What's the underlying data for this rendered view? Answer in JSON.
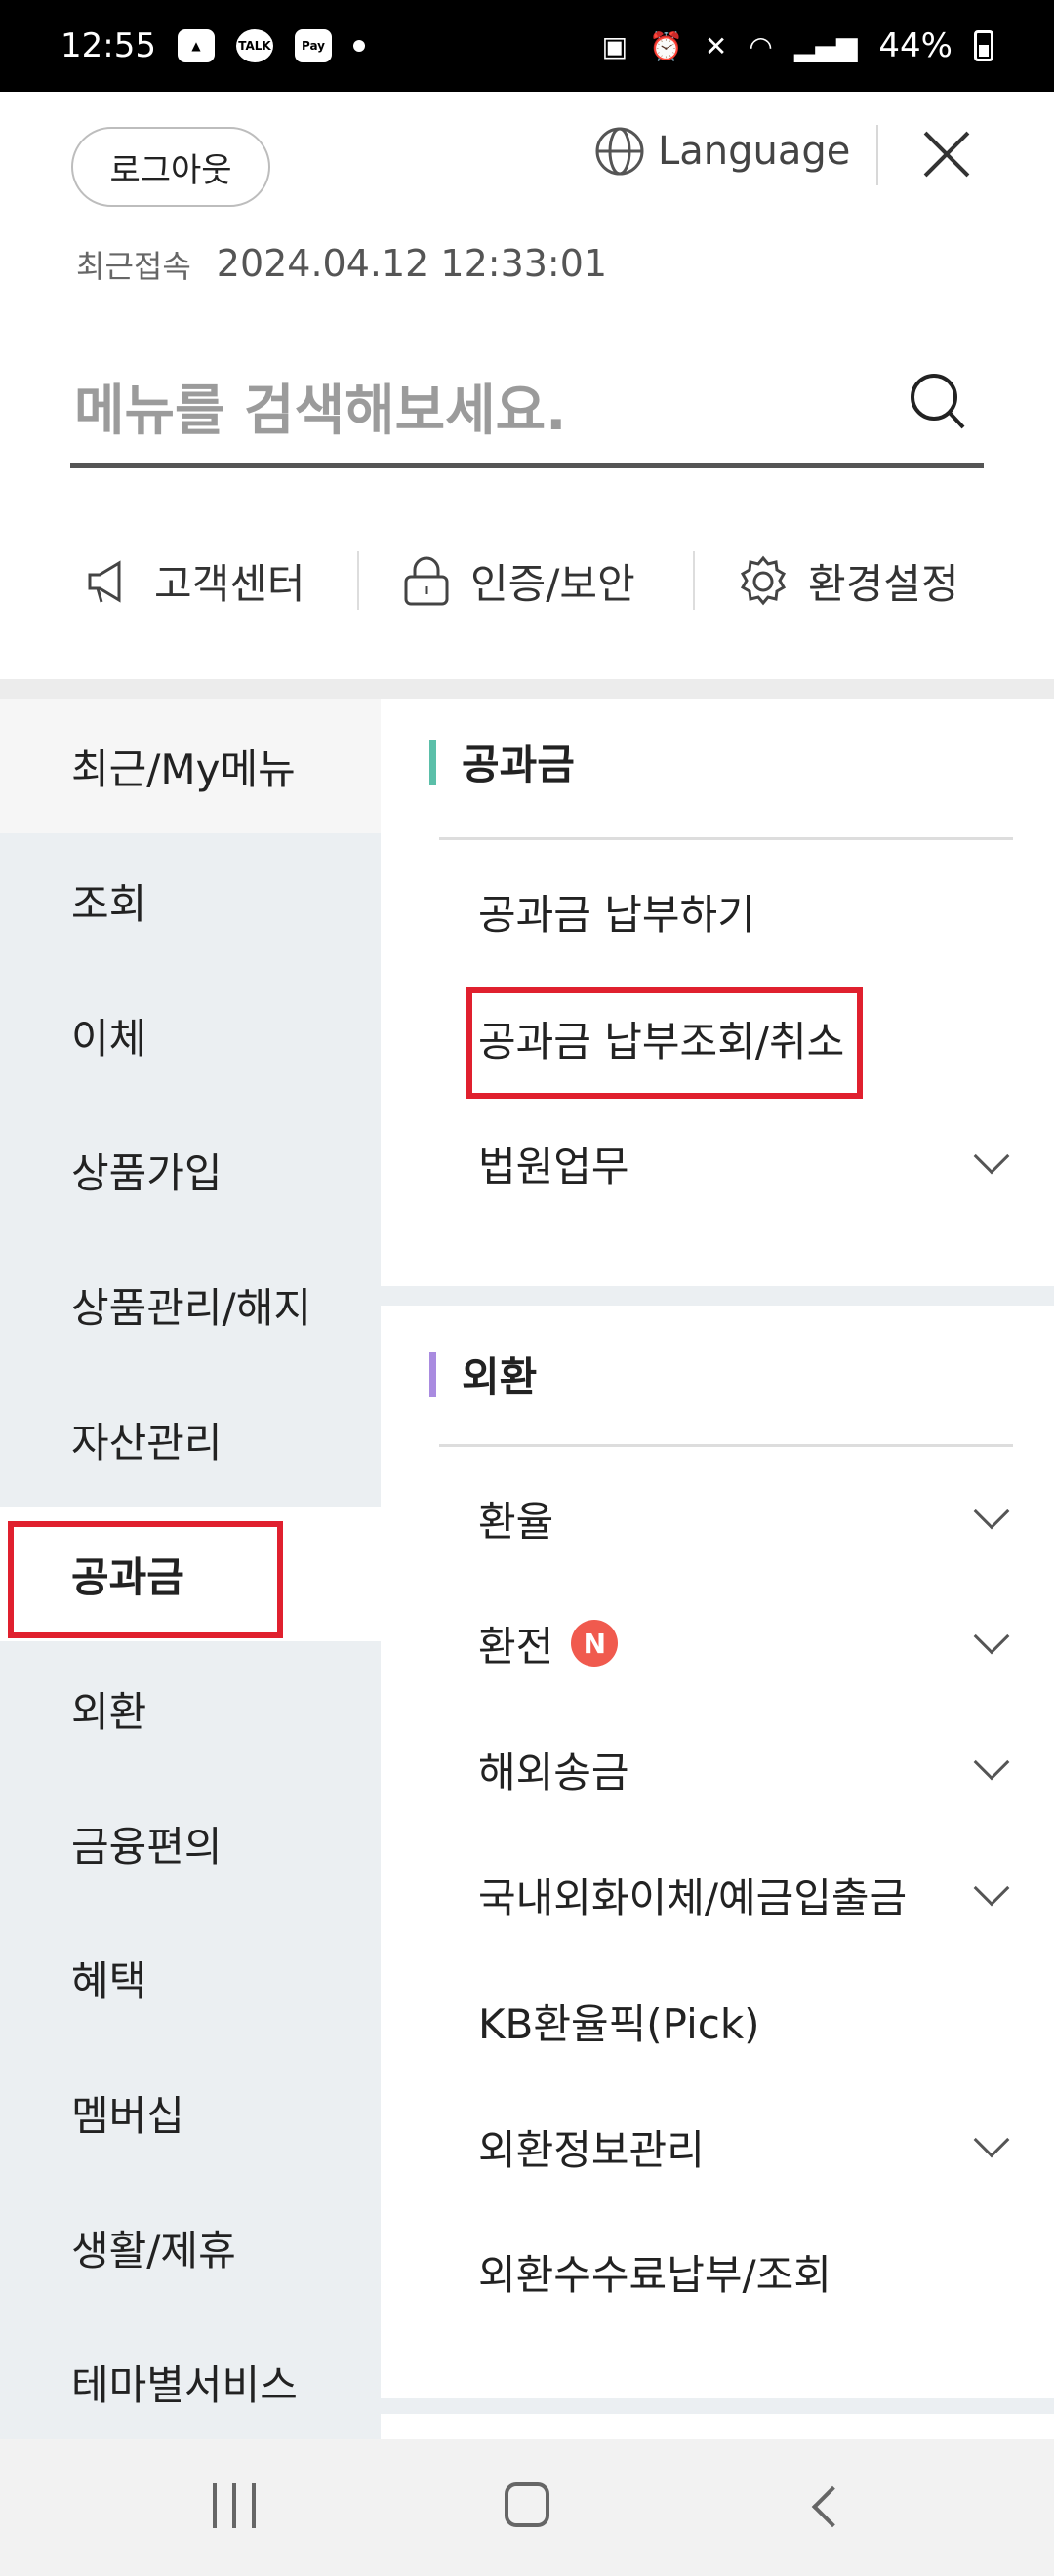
{
  "status_bar": {
    "time": "12:55",
    "battery": "44%",
    "talk_label": "TALK",
    "pay_label": "Pay"
  },
  "header": {
    "logout": "로그아웃",
    "language": "Language",
    "last_login_label": "최근접속",
    "last_login_time": "2024.04.12 12:33:01"
  },
  "search": {
    "placeholder": "메뉴를 검색해보세요."
  },
  "quick_menu": [
    {
      "label": "고객센터",
      "icon": "megaphone-icon"
    },
    {
      "label": "인증/보안",
      "icon": "lock-icon"
    },
    {
      "label": "환경설정",
      "icon": "gear-icon"
    }
  ],
  "left_menu": [
    "최근/My메뉴",
    "조회",
    "이체",
    "상품가입",
    "상품관리/해지",
    "자산관리",
    "공과금",
    "외환",
    "금융편의",
    "혜택",
    "멤버십",
    "생활/제휴",
    "테마별서비스"
  ],
  "left_menu_active": "공과금",
  "sections": [
    {
      "title": "공과금",
      "accent": "#5bbfa9",
      "items": [
        {
          "label": "공과금 납부하기",
          "expandable": false
        },
        {
          "label": "공과금 납부조회/취소",
          "expandable": false
        },
        {
          "label": "법원업무",
          "expandable": true
        }
      ]
    },
    {
      "title": "외환",
      "accent": "#a98be0",
      "items": [
        {
          "label": "환율",
          "expandable": true
        },
        {
          "label": "환전",
          "expandable": true,
          "badge": "N"
        },
        {
          "label": "해외송금",
          "expandable": true
        },
        {
          "label": "국내외화이체/예금입출금",
          "expandable": true
        },
        {
          "label": "KB환율픽(Pick)",
          "expandable": false
        },
        {
          "label": "외환정보관리",
          "expandable": true
        },
        {
          "label": "외환수수료납부/조회",
          "expandable": false
        }
      ]
    }
  ],
  "highlight_color": "#e0202e"
}
